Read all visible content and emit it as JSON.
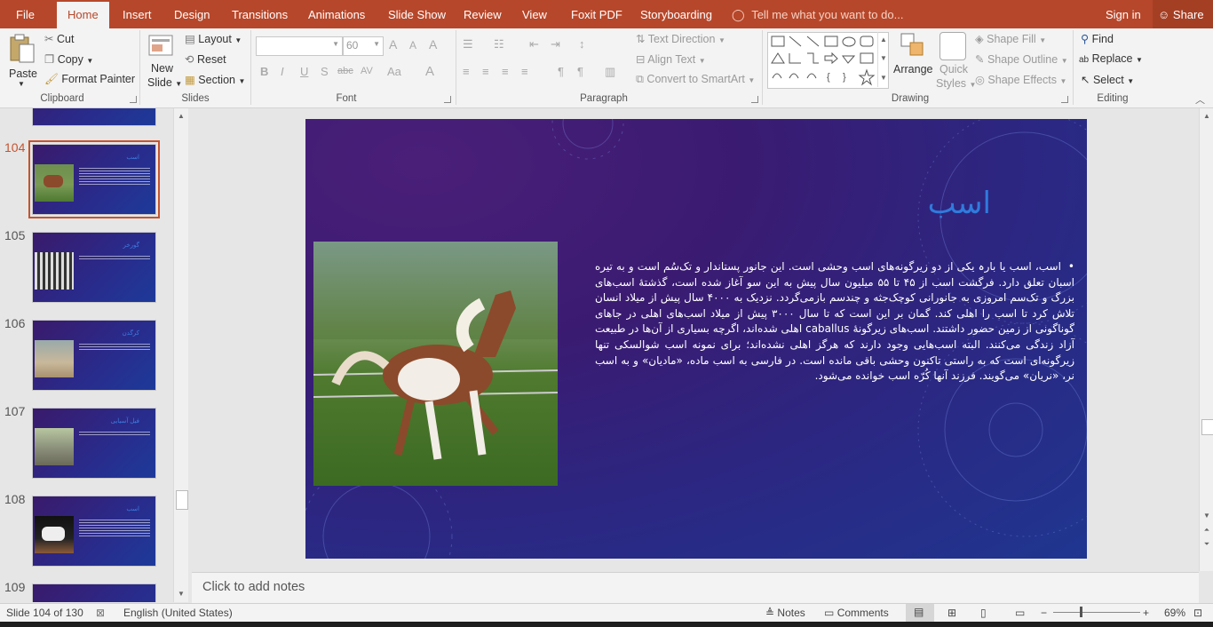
{
  "tabs": [
    "File",
    "Home",
    "Insert",
    "Design",
    "Transitions",
    "Animations",
    "Slide Show",
    "Review",
    "View",
    "Foxit PDF",
    "Storyboarding"
  ],
  "tell_me": "Tell me what you want to do...",
  "sign_in": "Sign in",
  "share": "Share",
  "clipboard": {
    "paste": "Paste",
    "cut": "Cut",
    "copy": "Copy",
    "format_painter": "Format Painter",
    "label": "Clipboard"
  },
  "slides_group": {
    "new_slide_1": "New",
    "new_slide_2": "Slide",
    "layout": "Layout",
    "reset": "Reset",
    "section": "Section",
    "label": "Slides"
  },
  "font_group": {
    "size": "60",
    "label": "Font",
    "bold": "B",
    "italic": "I",
    "underline": "U",
    "shadow": "S",
    "strike": "abc",
    "spacing": "AV",
    "case": "Aa",
    "color": "A",
    "grow": "A",
    "shrink": "A",
    "clear": "A"
  },
  "paragraph_group": {
    "text_direction": "Text Direction",
    "align_text": "Align Text",
    "convert_smartart": "Convert to SmartArt",
    "label": "Paragraph"
  },
  "drawing_group": {
    "arrange": "Arrange",
    "quick_styles_1": "Quick",
    "quick_styles_2": "Styles",
    "shape_fill": "Shape Fill",
    "shape_outline": "Shape Outline",
    "shape_effects": "Shape Effects",
    "label": "Drawing"
  },
  "editing_group": {
    "find": "Find",
    "replace": "Replace",
    "select": "Select",
    "label": "Editing"
  },
  "thumbnails": [
    {
      "num": "104",
      "selected": true
    },
    {
      "num": "105",
      "selected": false
    },
    {
      "num": "106",
      "selected": false
    },
    {
      "num": "107",
      "selected": false
    },
    {
      "num": "108",
      "selected": false
    },
    {
      "num": "109",
      "selected": false
    }
  ],
  "slide": {
    "title": "اسب",
    "body": "اسب، اسب یا بارہ یکی از دو زیرگونه‌های اسب وحشی است. این جانور پستاندار و تک‌سُم است و به تیره اسبان تعلق دارد. فرگشت اسب از ۴۵ تا ۵۵ میلیون سال پیش به این سو آغاز شده است، گذشتهٔ اسب‌های بزرگ و تک‌سم امروزی به جانورانی کوچک‌جثه و چندسم بازمی‌گردد. نزدیک به ۴۰۰۰ سال پیش از میلاد انسان تلاش کرد تا اسب را اهلی کند. گمان بر این است که تا سال ۳۰۰۰ پیش از میلاد اسب‌های اهلی در جاهای گوناگونی از زمین حضور داشتند. اسب‌های زیرگونهٔ caballus اهلی شده‌اند، اگرچه بسیاری از آن‌ها در طبیعت آزاد زندگی می‌کنند. البته اسب‌هایی وجود دارند که هرگز اهلی نشده‌اند؛ برای نمونه اسب شوالسکی تنها زیرگونه‌ای است که به راستی تاکنون وحشی باقی مانده است. در فارسی به اسب ماده، «مادیان» و به اسب نر، «نریان» می‌گویند. فرزند آنها کُرّه اسب خوانده می‌شود."
  },
  "notes_placeholder": "Click to add notes",
  "status": {
    "slide_info": "Slide 104 of 130",
    "language": "English (United States)",
    "notes": "Notes",
    "comments": "Comments",
    "zoom": "69%"
  },
  "colors": {
    "accent": "#b7472a",
    "title_blue": "#2f7bdc",
    "slide_bg": "#3a1b72"
  }
}
